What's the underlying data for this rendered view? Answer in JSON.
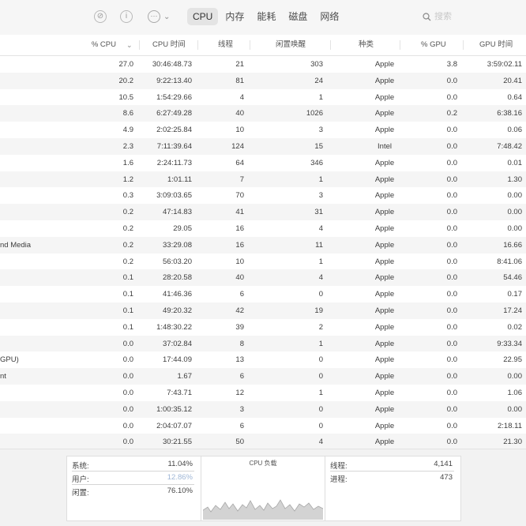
{
  "toolbar": {
    "stop_icon": "stop-process-icon",
    "info_icon": "info-icon",
    "more_icon": "more-icon",
    "tabs": [
      "CPU",
      "内存",
      "能耗",
      "磁盘",
      "网络"
    ],
    "active_tab": 0,
    "search_placeholder": "搜索"
  },
  "table": {
    "headers": {
      "cpu": "% CPU",
      "cpu_time": "CPU 时间",
      "threads": "线程",
      "idle_wakeups": "闲置唤醒",
      "kind": "种类",
      "gpu": "% GPU",
      "gpu_time": "GPU 时间"
    },
    "rows": [
      {
        "name": "",
        "cpu": "27.0",
        "cpu_time": "30:46:48.73",
        "threads": "21",
        "idle": "303",
        "kind": "Apple",
        "gpu": "3.8",
        "gpu_time": "3:59:02.11"
      },
      {
        "name": "",
        "cpu": "20.2",
        "cpu_time": "9:22:13.40",
        "threads": "81",
        "idle": "24",
        "kind": "Apple",
        "gpu": "0.0",
        "gpu_time": "20.41"
      },
      {
        "name": "",
        "cpu": "10.5",
        "cpu_time": "1:54:29.66",
        "threads": "4",
        "idle": "1",
        "kind": "Apple",
        "gpu": "0.0",
        "gpu_time": "0.64"
      },
      {
        "name": "",
        "cpu": "8.6",
        "cpu_time": "6:27:49.28",
        "threads": "40",
        "idle": "1026",
        "kind": "Apple",
        "gpu": "0.2",
        "gpu_time": "6:38.16"
      },
      {
        "name": "",
        "cpu": "4.9",
        "cpu_time": "2:02:25.84",
        "threads": "10",
        "idle": "3",
        "kind": "Apple",
        "gpu": "0.0",
        "gpu_time": "0.06"
      },
      {
        "name": "",
        "cpu": "2.3",
        "cpu_time": "7:11:39.64",
        "threads": "124",
        "idle": "15",
        "kind": "Intel",
        "gpu": "0.0",
        "gpu_time": "7:48.42"
      },
      {
        "name": "",
        "cpu": "1.6",
        "cpu_time": "2:24:11.73",
        "threads": "64",
        "idle": "346",
        "kind": "Apple",
        "gpu": "0.0",
        "gpu_time": "0.01"
      },
      {
        "name": "",
        "cpu": "1.2",
        "cpu_time": "1:01.11",
        "threads": "7",
        "idle": "1",
        "kind": "Apple",
        "gpu": "0.0",
        "gpu_time": "1.30"
      },
      {
        "name": "",
        "cpu": "0.3",
        "cpu_time": "3:09:03.65",
        "threads": "70",
        "idle": "3",
        "kind": "Apple",
        "gpu": "0.0",
        "gpu_time": "0.00"
      },
      {
        "name": "",
        "cpu": "0.2",
        "cpu_time": "47:14.83",
        "threads": "41",
        "idle": "31",
        "kind": "Apple",
        "gpu": "0.0",
        "gpu_time": "0.00"
      },
      {
        "name": "",
        "cpu": "0.2",
        "cpu_time": "29.05",
        "threads": "16",
        "idle": "4",
        "kind": "Apple",
        "gpu": "0.0",
        "gpu_time": "0.00"
      },
      {
        "name": "nd Media",
        "cpu": "0.2",
        "cpu_time": "33:29.08",
        "threads": "16",
        "idle": "11",
        "kind": "Apple",
        "gpu": "0.0",
        "gpu_time": "16.66"
      },
      {
        "name": "",
        "cpu": "0.2",
        "cpu_time": "56:03.20",
        "threads": "10",
        "idle": "1",
        "kind": "Apple",
        "gpu": "0.0",
        "gpu_time": "8:41.06"
      },
      {
        "name": "",
        "cpu": "0.1",
        "cpu_time": "28:20.58",
        "threads": "40",
        "idle": "4",
        "kind": "Apple",
        "gpu": "0.0",
        "gpu_time": "54.46"
      },
      {
        "name": "",
        "cpu": "0.1",
        "cpu_time": "41:46.36",
        "threads": "6",
        "idle": "0",
        "kind": "Apple",
        "gpu": "0.0",
        "gpu_time": "0.17"
      },
      {
        "name": "",
        "cpu": "0.1",
        "cpu_time": "49:20.32",
        "threads": "42",
        "idle": "19",
        "kind": "Apple",
        "gpu": "0.0",
        "gpu_time": "17.24"
      },
      {
        "name": "",
        "cpu": "0.1",
        "cpu_time": "1:48:30.22",
        "threads": "39",
        "idle": "2",
        "kind": "Apple",
        "gpu": "0.0",
        "gpu_time": "0.02"
      },
      {
        "name": "",
        "cpu": "0.0",
        "cpu_time": "37:02.84",
        "threads": "8",
        "idle": "1",
        "kind": "Apple",
        "gpu": "0.0",
        "gpu_time": "9:33.34"
      },
      {
        "name": "GPU)",
        "cpu": "0.0",
        "cpu_time": "17:44.09",
        "threads": "13",
        "idle": "0",
        "kind": "Apple",
        "gpu": "0.0",
        "gpu_time": "22.95"
      },
      {
        "name": "nt",
        "cpu": "0.0",
        "cpu_time": "1.67",
        "threads": "6",
        "idle": "0",
        "kind": "Apple",
        "gpu": "0.0",
        "gpu_time": "0.00"
      },
      {
        "name": "",
        "cpu": "0.0",
        "cpu_time": "7:43.71",
        "threads": "12",
        "idle": "1",
        "kind": "Apple",
        "gpu": "0.0",
        "gpu_time": "1.06"
      },
      {
        "name": "",
        "cpu": "0.0",
        "cpu_time": "1:00:35.12",
        "threads": "3",
        "idle": "0",
        "kind": "Apple",
        "gpu": "0.0",
        "gpu_time": "0.00"
      },
      {
        "name": "",
        "cpu": "0.0",
        "cpu_time": "2:04:07.07",
        "threads": "6",
        "idle": "0",
        "kind": "Apple",
        "gpu": "0.0",
        "gpu_time": "2:18.11"
      },
      {
        "name": "",
        "cpu": "0.0",
        "cpu_time": "30:21.55",
        "threads": "50",
        "idle": "4",
        "kind": "Apple",
        "gpu": "0.0",
        "gpu_time": "21.30"
      }
    ]
  },
  "summary": {
    "system_label": "系统:",
    "system_value": "11.04%",
    "user_label": "用户:",
    "user_value": "12.86%",
    "idle_label": "闲置:",
    "idle_value": "76.10%",
    "cpu_load_title": "CPU 负载",
    "threads_label": "线程:",
    "threads_value": "4,141",
    "processes_label": "进程:",
    "processes_value": "473"
  },
  "colors": {
    "user_value": "#9fb6d6",
    "graph_fill": "#d3d3d3",
    "graph_line": "#a8a8a8"
  }
}
